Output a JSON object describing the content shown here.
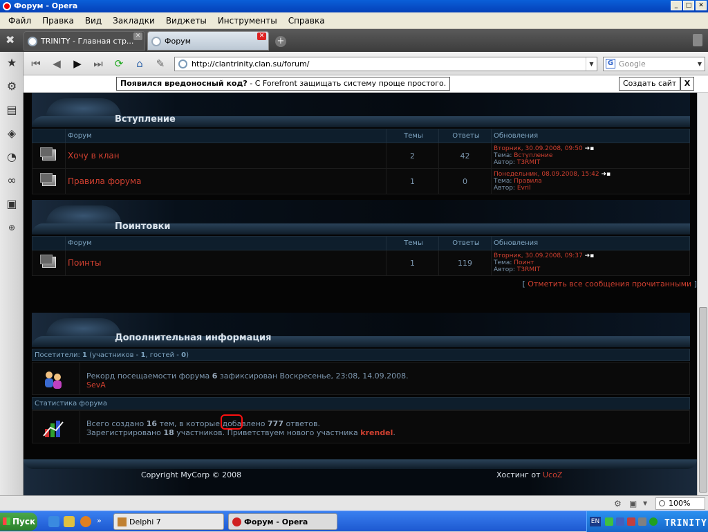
{
  "window": {
    "title": "Форум - Opera"
  },
  "menu": [
    "Файл",
    "Правка",
    "Вид",
    "Закладки",
    "Виджеты",
    "Инструменты",
    "Справка"
  ],
  "tabs": [
    {
      "label": "TRINITY - Главная стр..."
    },
    {
      "label": "Форум"
    }
  ],
  "address": {
    "url": "http://clantrinity.clan.su/forum/"
  },
  "search": {
    "placeholder": "Google"
  },
  "adbar": {
    "bold": "Появился вредоносный код?",
    "text": " - C Forefront защищать систему проще простого.",
    "button": "Создать сайт",
    "close": "X"
  },
  "forum": {
    "columns": {
      "forum": "Форум",
      "topics": "Темы",
      "replies": "Ответы",
      "updates": "Обновления"
    },
    "sections": [
      {
        "title": "Вступление",
        "rows": [
          {
            "name": "Хочу в клан",
            "topics": "2",
            "replies": "42",
            "date": "Вторник, 30.09.2008, 09:50",
            "topic_label": "Тема:",
            "topic": "Вступление",
            "author_label": "Автор:",
            "author": "T3RMIT"
          },
          {
            "name": "Правила форума",
            "topics": "1",
            "replies": "0",
            "date": "Понедельник, 08.09.2008, 15:42",
            "topic_label": "Тема:",
            "topic": "Правила",
            "author_label": "Автор:",
            "author": "Evril"
          }
        ]
      },
      {
        "title": "Поинтовки",
        "rows": [
          {
            "name": "Поинты",
            "topics": "1",
            "replies": "119",
            "date": "Вторник, 30.09.2008, 09:37",
            "topic_label": "Тема:",
            "topic": "Поинт",
            "author_label": "Автор:",
            "author": "T3RMIT"
          }
        ]
      }
    ],
    "mark_all": {
      "open": "[",
      "text": "Отметить все сообщения прочитанными",
      "close": "]"
    }
  },
  "info": {
    "title": "Дополнительная информация",
    "visitors": {
      "label": "Посетители:",
      "total": "1",
      "mid1": "(участников -",
      "members": "1",
      "mid2": ", гостей -",
      "guests": "0",
      "end": ")"
    },
    "record": {
      "pre": "Рекорд посещаемости форума",
      "count": "6",
      "post": "зафиксирован Воскресенье, 23:08, 14.09.2008.",
      "user": "SevA"
    },
    "stats_label": "Статистика форума",
    "stats": {
      "pre": "Всего создано",
      "topics": "16",
      "mid": "тем, в которые добавлено",
      "replies": "777",
      "post": "ответов.",
      "reg_pre": "Зарегистрировано",
      "reg_count": "18",
      "reg_mid": "участников. Приветствуем нового участника",
      "new_user": "krendel",
      "end": "."
    }
  },
  "footer": {
    "copyright": "Copyright MyCorp © 2008",
    "hosting_label": "Хостинг от",
    "hosting": "UcoZ"
  },
  "statusbar": {
    "zoom": "100%"
  },
  "taskbar": {
    "start": "Пуск",
    "items": [
      {
        "label": "Delphi 7"
      },
      {
        "label": "Форум - Opera"
      }
    ],
    "lang": "EN",
    "tray_text": "TRINITY"
  },
  "colors": {
    "link_red": "#d04030",
    "header_blue": "#7ea4c0",
    "text_gray": "#7e98b0"
  }
}
